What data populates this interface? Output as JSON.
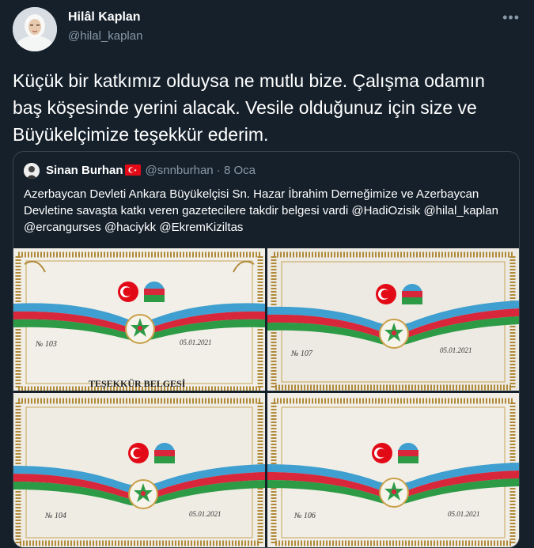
{
  "tweet": {
    "display_name": "Hilâl Kaplan",
    "handle": "@hilal_kaplan",
    "more_icon": "more-horizontal-icon",
    "text": "Küçük bir katkımız olduysa ne mutlu bize. Çalışma odamın baş köşesinde yerini alacak. Vesile olduğunuz için size ve Büyükelçimize teşekkür ederim."
  },
  "quoted": {
    "display_name": "Sinan Burhan",
    "handle": "@snnburhan",
    "separator": "·",
    "date": "8 Oca",
    "text": "Azerbaycan Devleti Ankara Büyükelçisi Sn. Hazar İbrahim Derneğimize ve Azerbaycan Devletine savaşta katkı veren gazetecilere takdir belgesi vardi @HadiOzisik @hilal_kaplan @ercangurses @haciykk @EkremKiziltas",
    "photos": [
      {
        "number": "№ 103",
        "date": "05.01.2021",
        "title": "TEŞEKKÜR BELGESİ"
      },
      {
        "number": "№ 107",
        "date": "05.01.2021"
      },
      {
        "number": "№ 104",
        "date": "05.01.2021"
      },
      {
        "number": "№ 106",
        "date": "05.01.2021"
      }
    ]
  },
  "colors": {
    "background": "#15202b",
    "secondary_text": "#8899a6",
    "border": "#38444d",
    "turkey_red": "#e30a17",
    "az_blue": "#3f9fd0",
    "az_red": "#d8263a",
    "az_green": "#2d9a46",
    "frame_gold": "#b08a3a"
  }
}
